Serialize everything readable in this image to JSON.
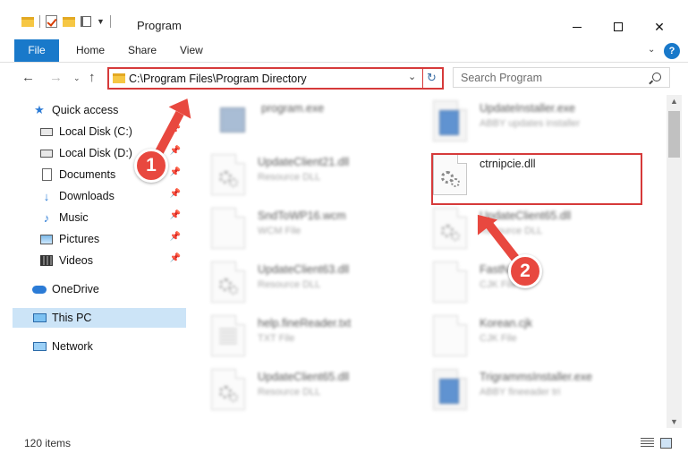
{
  "window": {
    "title": "Program"
  },
  "ribbon": {
    "tabs": [
      "File",
      "Home",
      "Share",
      "View"
    ]
  },
  "address": {
    "path": "C:\\Program Files\\Program Directory",
    "search_placeholder": "Search Program"
  },
  "sidebar": {
    "items": [
      {
        "label": "Quick access",
        "icon": "star-icon"
      },
      {
        "label": "Local Disk (C:)",
        "icon": "drive-icon"
      },
      {
        "label": "Local Disk (D:)",
        "icon": "drive-icon"
      },
      {
        "label": "Documents",
        "icon": "documents-icon"
      },
      {
        "label": "Downloads",
        "icon": "downloads-icon"
      },
      {
        "label": "Music",
        "icon": "music-icon"
      },
      {
        "label": "Pictures",
        "icon": "pictures-icon"
      },
      {
        "label": "Videos",
        "icon": "videos-icon"
      },
      {
        "label": "OneDrive",
        "icon": "cloud-icon"
      },
      {
        "label": "This PC",
        "icon": "computer-icon",
        "selected": true
      },
      {
        "label": "Network",
        "icon": "network-icon"
      }
    ]
  },
  "files": [
    {
      "name": "program.exe",
      "type": ""
    },
    {
      "name": "UpdateInstaller.exe",
      "type": "ABBY updates installer"
    },
    {
      "name": "UpdateClient21.dll",
      "type": "Resource DLL"
    },
    {
      "name": "ctrnipcie.dll",
      "type": ""
    },
    {
      "name": "SndToWP16.wcm",
      "type": "WCM File"
    },
    {
      "name": "UpdateClient65.dll",
      "type": "Resource DLL"
    },
    {
      "name": "UpdateClient63.dll",
      "type": "Resource DLL"
    },
    {
      "name": "FastN",
      "type": "CJK File"
    },
    {
      "name": "help.fineReader.txt",
      "type": "TXT File"
    },
    {
      "name": "Korean.cjk",
      "type": "CJK File"
    },
    {
      "name": "UpdateClient65.dll",
      "type": "Resource DLL"
    },
    {
      "name": "TrigrammsInstaller.exe",
      "type": "ABBY fineeader tri"
    }
  ],
  "status": {
    "item_count": "120 items"
  },
  "callouts": [
    "1",
    "2"
  ],
  "colors": {
    "accent": "#1979ca",
    "highlight": "#d63a3a",
    "callout": "#e8483f",
    "selected_bg": "#cce4f7"
  }
}
